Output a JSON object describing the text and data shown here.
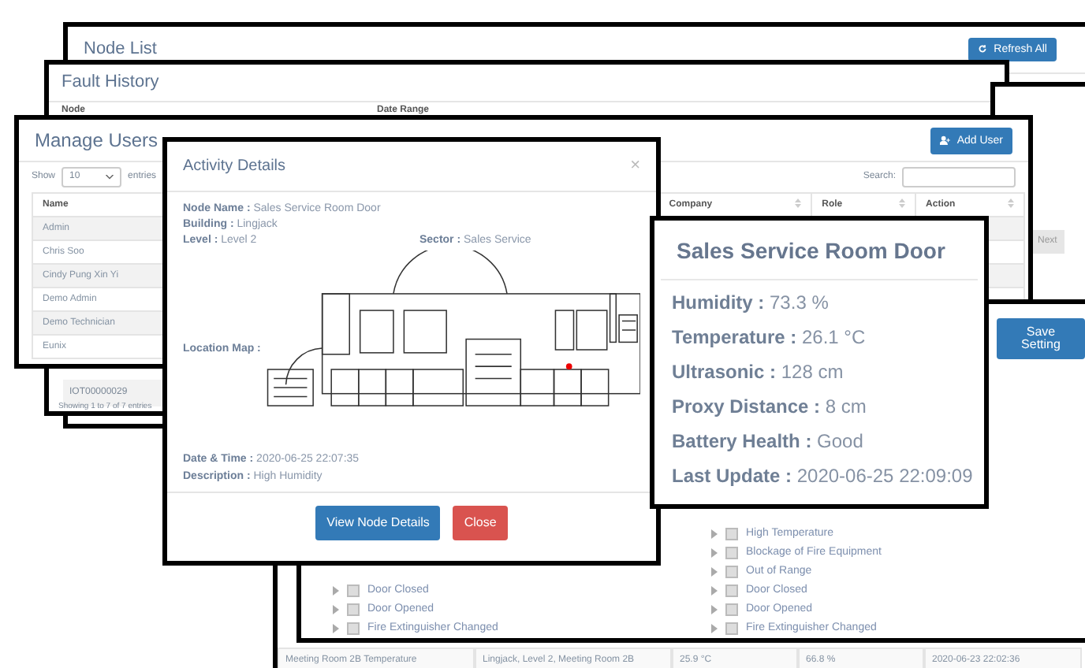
{
  "node_list": {
    "title": "Node List",
    "button": "Refresh All"
  },
  "sensor_table": {
    "row": [
      "Meeting Room 2B Temperature",
      "Lingjack, Level 2, Meeting Room 2B",
      "25.9 °C",
      "66.8 %",
      "2020-06-23 22:02:36"
    ]
  },
  "fault_history": {
    "title": "Fault History",
    "labels": [
      "Node",
      "Date Range"
    ],
    "cell": "IOT00000029",
    "footer": "Showing 1 to 7 of 7 entries"
  },
  "pager_window": {
    "button": "Next"
  },
  "alert_settings": {
    "button": "Save Setting",
    "columns": [
      [
        {
          "label": "Door Closed",
          "checked": false
        },
        {
          "label": "Door Opened",
          "checked": false
        },
        {
          "label": "Fire Extinguisher Changed",
          "checked": false
        }
      ],
      [
        {
          "label": "High Temperature",
          "checked": false
        },
        {
          "label": "Blockage of Fire Equipment",
          "checked": false
        },
        {
          "label": "Out of Range",
          "checked": false
        },
        {
          "label": "Door Closed",
          "checked": false
        },
        {
          "label": "Door Opened",
          "checked": false
        },
        {
          "label": "Fire Extinguisher Changed",
          "checked": false
        }
      ]
    ]
  },
  "manage_users": {
    "title": "Manage Users",
    "button": "Add User",
    "show_label": "Show",
    "entries_value": "10",
    "entries_label": "entries",
    "search_label": "Search:",
    "columns": [
      "Name",
      "Company",
      "Role",
      "Action"
    ],
    "rows": [
      "Admin",
      "Chris Soo",
      "Cindy Pung Xin Yi",
      "Demo Admin",
      "Demo Technician",
      "Eunix"
    ]
  },
  "activity_details": {
    "title": "Activity Details",
    "close": "×",
    "fields": [
      "**Node Name :** Sales Service Room Door",
      "**Building :** Lingjack",
      "**Level :** Level 2"
    ],
    "sector": "**Sector :** Sales Service",
    "map_label": "Location Map :",
    "footer_fields": [
      "**Date & Time :** 2020-06-25 22:07:35",
      "**Description :** High Humidity"
    ],
    "buttons": [
      {
        "label": "View Node Details",
        "kind": "primary"
      },
      {
        "label": "Close",
        "kind": "danger"
      }
    ]
  },
  "node_card": {
    "title": "Sales Service Room Door",
    "readings": [
      "**Humidity :** 73.3 %",
      "**Temperature :** 26.1 °C",
      "**Ultrasonic :** 128 cm",
      "**Proxy Distance :** 8 cm",
      "**Battery Health :** Good",
      "**Last Update :** 2020-06-25 22:09:09"
    ]
  }
}
